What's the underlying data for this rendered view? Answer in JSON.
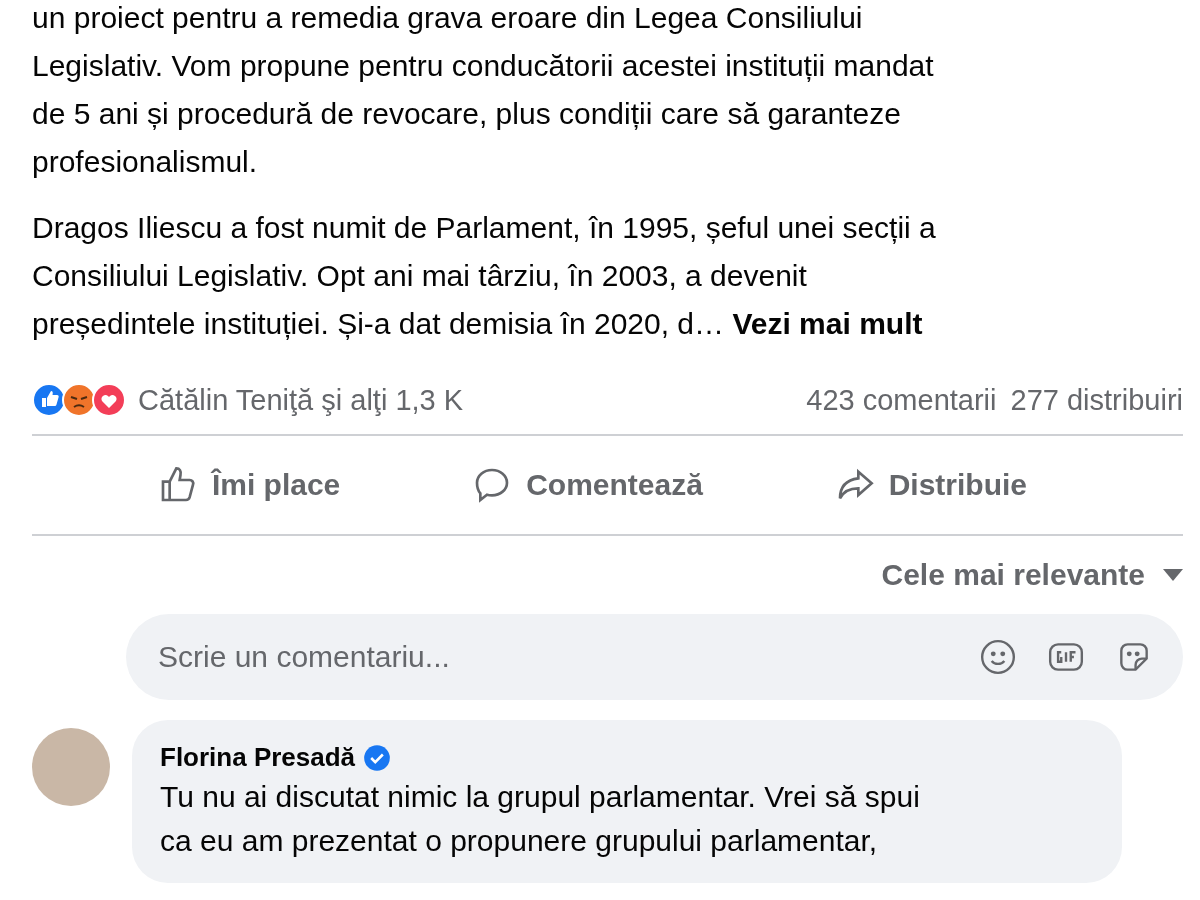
{
  "post": {
    "paragraphs": [
      "un proiect pentru a remedia grava eroare din Legea Consiliului\nLegislativ. Vom propune pentru conducătorii acestei instituții mandat\nde 5 ani și procedură de revocare, plus condiții care să garanteze\nprofesionalismul.",
      "Dragos Iliescu a fost numit de Parlament, în 1995, șeful unei secții a\nConsiliului Legislativ.  Opt ani mai târziu, în 2003, a devenit\npreședintele instituției. Și-a dat demisia în 2020, d…"
    ],
    "see_more": "Vezi mai mult"
  },
  "reactions": {
    "types": [
      {
        "kind": "like"
      },
      {
        "kind": "angry"
      },
      {
        "kind": "love"
      }
    ],
    "summary": "Cătălin Teniţă şi alţi 1,3 K",
    "comments": "423 comentarii",
    "shares": "277 distribuiri"
  },
  "actions": [
    {
      "kind": "like",
      "label": "Îmi place"
    },
    {
      "kind": "comment",
      "label": "Comentează"
    },
    {
      "kind": "share",
      "label": "Distribuie"
    }
  ],
  "sort": "Cele mai relevante",
  "comment_input": {
    "placeholder": "Scrie un comentariu..."
  },
  "comments": [
    {
      "author": "Florina Presadă",
      "verified": true,
      "text": "Tu nu ai discutat nimic la grupul parlamentar. Vrei să spui\nca eu am prezentat o propunere grupului parlamentar,"
    }
  ]
}
